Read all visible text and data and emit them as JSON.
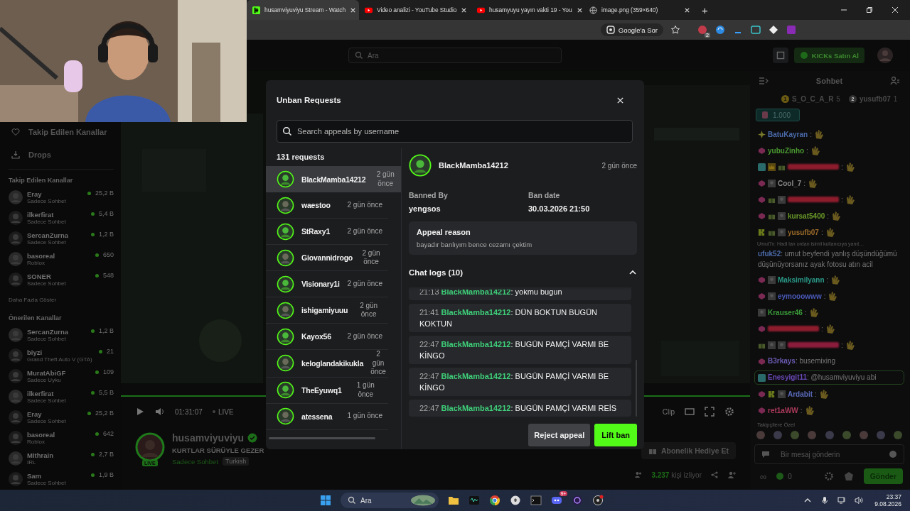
{
  "browser": {
    "tabs": [
      {
        "title": "husamviyuviyu Stream - Watch",
        "kind": "kick",
        "selected": true
      },
      {
        "title": "Video analizi - YouTube Studio",
        "kind": "youtube",
        "selected": false
      },
      {
        "title": "husamyuyu yayın vakti 19 - You",
        "kind": "youtube",
        "selected": false
      },
      {
        "title": "image.png (359×640)",
        "kind": "globe",
        "selected": false
      }
    ],
    "new_tab": "+",
    "lens_chip": "Google'a Sor",
    "extension_badge": "2"
  },
  "site_header": {
    "search_placeholder": "Ara",
    "kicks_button": "KICKs Satın Al"
  },
  "sidebar": {
    "nav": [
      {
        "label": "Takip Edilen Kanallar",
        "kind": "heart"
      },
      {
        "label": "Drops",
        "kind": "drops"
      }
    ],
    "sections": [
      {
        "title": "Takip Edilen Kanallar",
        "more": "Daha Fazla Göster",
        "channels": [
          {
            "name": "Eray",
            "category": "Sadece Sohbet",
            "viewers": "25,2 B"
          },
          {
            "name": "ilkerfirat",
            "category": "Sadece Sohbet",
            "viewers": "5,4 B"
          },
          {
            "name": "SercanZurna",
            "category": "Sadece Sohbet",
            "viewers": "1,2 B"
          },
          {
            "name": "basoreal",
            "category": "Roblox",
            "viewers": "650"
          },
          {
            "name": "SONER",
            "category": "Sadece Sohbet",
            "viewers": "548"
          }
        ]
      },
      {
        "title": "Önerilen Kanallar",
        "channels": [
          {
            "name": "SercanZurna",
            "category": "Sadece Sohbet",
            "viewers": "1,2 B"
          },
          {
            "name": "biyzi",
            "category": "Grand Theft Auto V (GTA)",
            "viewers": "21"
          },
          {
            "name": "MuratAbiGF",
            "category": "Sadece Uyku",
            "viewers": "109"
          },
          {
            "name": "ilkerfirat",
            "category": "Sadece Sohbet",
            "viewers": "5,5 B"
          },
          {
            "name": "Eray",
            "category": "Sadece Sohbet",
            "viewers": "25,2 B"
          },
          {
            "name": "basoreal",
            "category": "Roblox",
            "viewers": "642"
          },
          {
            "name": "Mithrain",
            "category": "IRL",
            "viewers": "2,7 B"
          },
          {
            "name": "Sam",
            "category": "Sadece Sohbet",
            "viewers": "1,9 B"
          }
        ]
      }
    ]
  },
  "player": {
    "time": "01:31:07",
    "live": "LIVE",
    "clip": "Clip"
  },
  "stream_info": {
    "name": "husamviyuviyu",
    "live_badge": "LIVE",
    "title": "KURTLAR SÜRÜYLE GEZER",
    "category": "Sadece Sohbet",
    "tag": "Turkish",
    "gift_button": "Abonelik Hediye Et",
    "viewers": "3.237",
    "viewers_suffix": "kişi izliyor"
  },
  "chat": {
    "title": "Sohbet",
    "leaders": [
      {
        "rank": "1",
        "name": "S_O_C_A_R",
        "count": "5"
      },
      {
        "rank": "2",
        "name": "yusufb07",
        "count": "1"
      }
    ],
    "pinned_amount": "1.000",
    "messages": [
      {
        "kind": "emote",
        "badges": [
          {
            "kind": "star"
          }
        ],
        "name": "BatuKayran",
        "color": "#4a6aa8",
        "text": ":",
        "mention": false
      },
      {
        "kind": "emote",
        "badges": [
          {
            "kind": "sub"
          }
        ],
        "name": "yubuZinho",
        "color": "#4a9a30",
        "text": ":",
        "mention": false
      },
      {
        "kind": "obscured",
        "badges": [
          {
            "kind": "num"
          },
          {
            "kind": "crown"
          },
          {
            "kind": "gift"
          }
        ],
        "color": "#8c1c2c",
        "text": ":",
        "mention": false
      },
      {
        "kind": "emote",
        "badges": [
          {
            "kind": "sub"
          },
          {
            "kind": "pic"
          }
        ],
        "name": "Cool_7",
        "color": "#8a8a8a",
        "text": ":",
        "mention": false
      },
      {
        "kind": "obscured",
        "badges": [
          {
            "kind": "sub"
          },
          {
            "kind": "gift"
          },
          {
            "kind": "pic"
          }
        ],
        "color": "#8c1c2c",
        "text": ":",
        "mention": false
      },
      {
        "kind": "emote",
        "badges": [
          {
            "kind": "sub"
          },
          {
            "kind": "gift"
          },
          {
            "kind": "pic"
          }
        ],
        "name": "kursat5400",
        "color": "#6a9a28",
        "text": ":",
        "mention": false
      },
      {
        "kind": "emote",
        "badges": [
          {
            "kind": "kick"
          },
          {
            "kind": "gift"
          },
          {
            "kind": "pic"
          }
        ],
        "name": "yusufb07",
        "color": "#9a6a28",
        "text": ":",
        "mention": false
      },
      {
        "kind": "text",
        "reply": "Umut7x: Hadi lan ordan isimli kullanıcıya yanıt…",
        "name": "ufuk52",
        "color": "#4a6aa8",
        "text": ": umut beyfendi yanlış düşündüğümü düşünüyorsanız ayak fotosu atın acil",
        "mention": false
      },
      {
        "kind": "emote",
        "badges": [
          {
            "kind": "sub"
          },
          {
            "kind": "pic"
          }
        ],
        "name": "Maksimilyann",
        "color": "#2a9a88",
        "text": ":",
        "mention": false
      },
      {
        "kind": "emote",
        "badges": [
          {
            "kind": "sub"
          },
          {
            "kind": "pic"
          }
        ],
        "name": "eymooowww",
        "color": "#4a5ab8",
        "text": ":",
        "mention": false
      },
      {
        "kind": "emote",
        "badges": [
          {
            "kind": "pic"
          }
        ],
        "name": "Krauser46",
        "color": "#3a9a38",
        "text": ":",
        "mention": false
      },
      {
        "kind": "obscured",
        "badges": [
          {
            "kind": "sub"
          }
        ],
        "color": "#8c1c2c",
        "text": ":",
        "mention": false
      },
      {
        "kind": "obscured",
        "badges": [
          {
            "kind": "gift"
          },
          {
            "kind": "pic"
          },
          {
            "kind": "pic"
          }
        ],
        "color": "#8c1c3c",
        "text": ":",
        "mention": false
      },
      {
        "kind": "text",
        "badges": [
          {
            "kind": "sub"
          }
        ],
        "name": "B3rkays",
        "color": "#6a5ab0",
        "text": ": busemixing",
        "mention": false
      },
      {
        "kind": "text",
        "badges": [
          {
            "kind": "num"
          }
        ],
        "name": "Enesyigit11",
        "color": "#6a4ab8",
        "text": ": @husamviyuviyu abi",
        "mention": true
      },
      {
        "kind": "emote",
        "badges": [
          {
            "kind": "sub"
          },
          {
            "kind": "kick"
          },
          {
            "kind": "pic"
          }
        ],
        "name": "Ardabit",
        "color": "#5a6ab8",
        "text": ":",
        "mention": false
      },
      {
        "kind": "emote",
        "badges": [
          {
            "kind": "sub"
          }
        ],
        "name": "ret1aWW",
        "color": "#aa3a5a",
        "text": ":",
        "mention": false
      }
    ],
    "followers_only": "Takipçilere Özel",
    "input_placeholder": "Bir mesaj gönderin",
    "infinity": "∞",
    "kicks_balance": "0",
    "send": "Gönder"
  },
  "modal": {
    "title": "Unban Requests",
    "search_placeholder": "Search appeals by username",
    "count": "131 requests",
    "requests": [
      {
        "name": "BlackMamba14212",
        "time": "2 gün önce",
        "selected": true
      },
      {
        "name": "waestoo",
        "time": "2 gün önce",
        "selected": false
      },
      {
        "name": "StRaxy1",
        "time": "2 gün önce",
        "selected": false
      },
      {
        "name": "Giovannidrogo",
        "time": "2 gün önce",
        "selected": false
      },
      {
        "name": "Visionary1i",
        "time": "2 gün önce",
        "selected": false
      },
      {
        "name": "ishigamiyuuu",
        "time": "2 gün önce",
        "selected": false
      },
      {
        "name": "Kayox56",
        "time": "2 gün önce",
        "selected": false
      },
      {
        "name": "keloglandakikukla",
        "time": "2 gün önce",
        "selected": false
      },
      {
        "name": "TheEyuwq1",
        "time": "1 gün önce",
        "selected": false
      },
      {
        "name": "atessena",
        "time": "1 gün önce",
        "selected": false
      }
    ],
    "detail": {
      "name": "BlackMamba14212",
      "time": "2 gün önce",
      "banned_by_label": "Banned By",
      "banned_by": "yengsos",
      "ban_date_label": "Ban date",
      "ban_date": "30.03.2026 21:50",
      "appeal_label": "Appeal reason",
      "appeal_text": "bayadır banlıyım bence cezamı çektim",
      "logs_title": "Chat logs (10)",
      "expanded": true,
      "logs": [
        {
          "time": "21:13",
          "user": "BlackMamba14212",
          "text": ": yokmu bugün"
        },
        {
          "time": "21:41",
          "user": "BlackMamba14212",
          "text": ": DÜN BOKTUN BUGÜN KOKTUN"
        },
        {
          "time": "22:47",
          "user": "BlackMamba14212",
          "text": ": BUGÜN PAMÇİ VARMI BE KİNGO"
        },
        {
          "time": "22:47",
          "user": "BlackMamba14212",
          "text": ": BUGÜN PAMÇİ VARMI BE KİNGO"
        },
        {
          "time": "22:47",
          "user": "BlackMamba14212",
          "text": ": BUGÜN PAMÇİ VARMI REİS"
        }
      ],
      "reject_button": "Reject appeal",
      "lift_button": "Lift ban"
    }
  },
  "taskbar": {
    "search_placeholder": "Ara",
    "notification_badge": "9+",
    "time": "23:37",
    "date": "9.08.2026"
  }
}
